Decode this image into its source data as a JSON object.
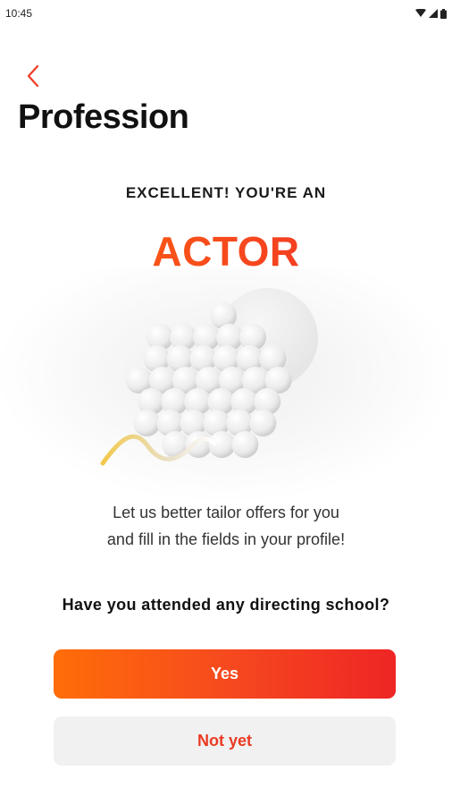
{
  "status_bar": {
    "time": "10:45",
    "icons": [
      "wifi-icon",
      "signal-icon",
      "battery-icon"
    ]
  },
  "header": {
    "back_icon": "chevron-left-icon",
    "title": "Profession"
  },
  "result": {
    "eyebrow": "EXCELLENT! YOU'RE AN",
    "profession": "ACTOR"
  },
  "description": {
    "line1": "Let us better tailor offers for you",
    "line2": "and fill in the fields in your profile!"
  },
  "question": "Have you attended any directing school?",
  "actions": {
    "yes_label": "Yes",
    "no_label": "Not yet"
  },
  "colors": {
    "accent_start": "#ff6d08",
    "accent_end": "#ee2525",
    "secondary_button_bg": "#f1f1f1"
  }
}
